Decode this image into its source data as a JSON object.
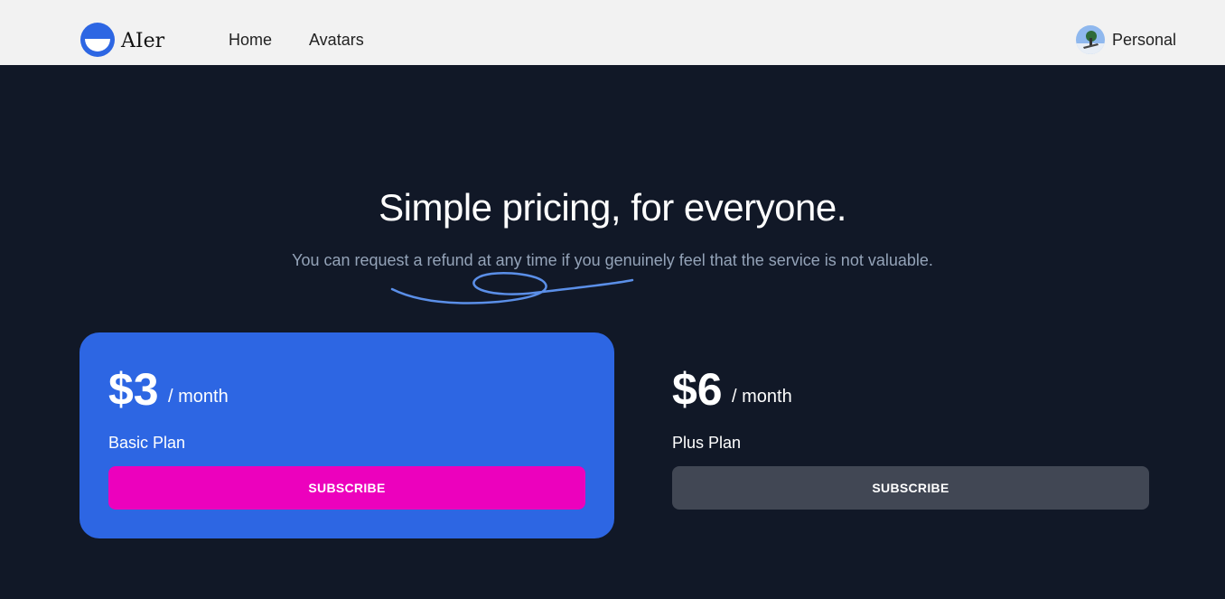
{
  "header": {
    "logo_text": "AIer",
    "nav": [
      {
        "label": "Home"
      },
      {
        "label": "Avatars"
      }
    ],
    "user_label": "Personal"
  },
  "hero": {
    "title": "Simple pricing, for everyone.",
    "subtitle": "You can request a refund at any time if you genuinely feel that the service is not valuable."
  },
  "plans": [
    {
      "price": "$3",
      "period": "/ month",
      "name": "Basic Plan",
      "button": "SUBSCRIBE"
    },
    {
      "price": "$6",
      "period": "/ month",
      "name": "Plus Plan",
      "button": "SUBSCRIBE"
    }
  ],
  "colors": {
    "header_bg": "#f2f2f2",
    "page_bg": "#111827",
    "accent_blue": "#2d66e3",
    "subscribe_pink": "#ec01bd",
    "subscribe_gray": "#414754"
  }
}
